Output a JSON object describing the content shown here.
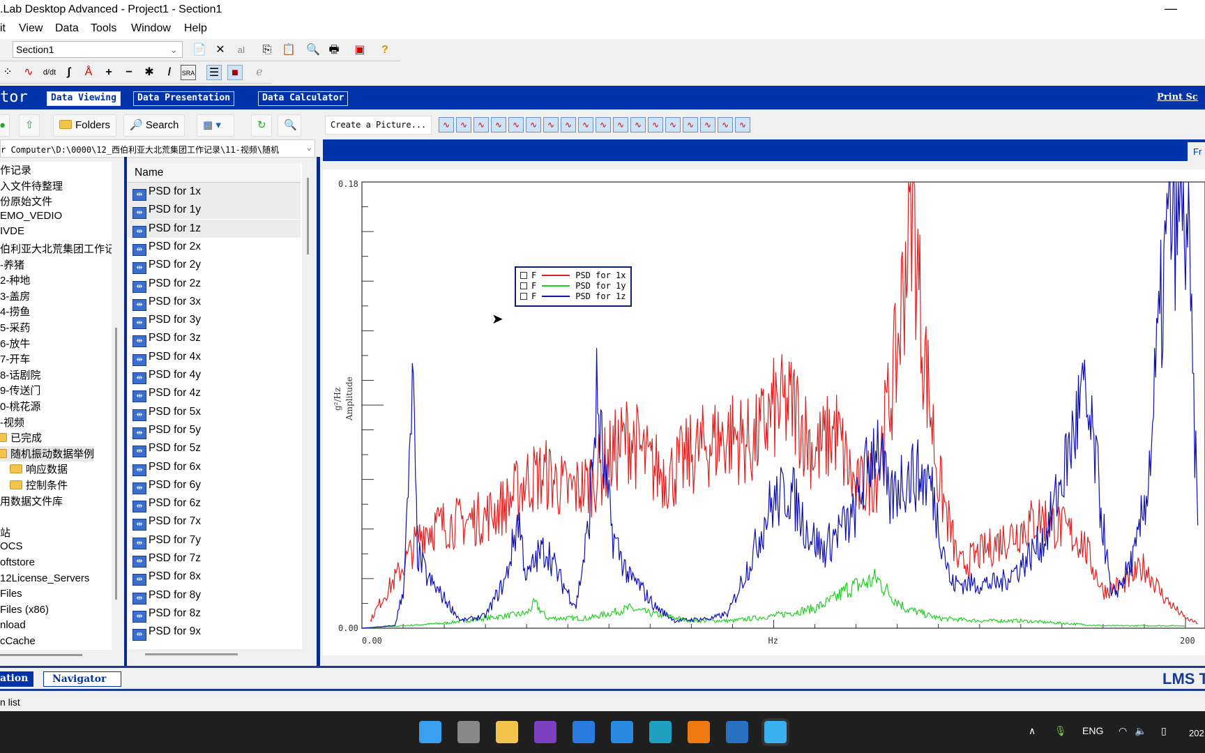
{
  "window": {
    "title": ".Lab Desktop Advanced - Project1 - Section1",
    "minimize": "—"
  },
  "menu": [
    "it",
    "View",
    "Data",
    "Tools",
    "Window",
    "Help"
  ],
  "toolbar": {
    "section_value": "Section1",
    "icons": [
      "new-document-icon",
      "delete-icon",
      "rename-icon",
      "copy-icon",
      "paste-icon",
      "print-preview-icon",
      "print-icon",
      "layout-icon",
      "help-icon"
    ]
  },
  "toolbar2": {
    "icons": [
      "scatter-icon",
      "curve-icon",
      "derivative-icon",
      "integral-icon",
      "annotate-icon",
      "plus-icon",
      "minus-icon",
      "multiply-icon",
      "divide-icon",
      "sra-icon",
      "list-view-icon",
      "save-icon",
      "web-icon"
    ]
  },
  "banner": {
    "app_fragment": "tor",
    "tabs": [
      "Data Viewing",
      "Data Presentation",
      "Data Calculator"
    ],
    "active_tab": "Data Viewing",
    "print_link": "Print Sc"
  },
  "nav": {
    "folders": "Folders",
    "search": "Search"
  },
  "path": "r Computer\\D:\\0000\\12_西伯利亚大北荒集团工作记录\\11-视频\\随机",
  "tree": [
    {
      "label": "作记录"
    },
    {
      "label": "入文件待整理"
    },
    {
      "label": "份原始文件"
    },
    {
      "label": "EMO_VEDIO"
    },
    {
      "label": "IVDE"
    },
    {
      "label": "伯利亚大北荒集团工作记"
    },
    {
      "label": "-养猪"
    },
    {
      "label": "2-种地"
    },
    {
      "label": "3-盖房"
    },
    {
      "label": "4-捞鱼"
    },
    {
      "label": "5-采药"
    },
    {
      "label": "6-放牛"
    },
    {
      "label": "7-开车"
    },
    {
      "label": "8-话剧院"
    },
    {
      "label": "9-传送门"
    },
    {
      "label": "0-桃花源"
    },
    {
      "label": "-视频"
    },
    {
      "label": "已完成",
      "folder": true
    },
    {
      "label": "随机振动数据举例",
      "folder": true,
      "selected": true
    },
    {
      "label": "响应数据",
      "folder": true,
      "indent": true
    },
    {
      "label": "控制条件",
      "folder": true,
      "indent": true
    },
    {
      "label": "用数据文件库"
    },
    {
      "label": ""
    },
    {
      "label": "站"
    },
    {
      "label": "OCS"
    },
    {
      "label": "oftstore"
    },
    {
      "label": "12License_Servers"
    },
    {
      "label": "Files"
    },
    {
      "label": "Files (x86)"
    },
    {
      "label": "nload"
    },
    {
      "label": "cCache"
    }
  ],
  "list": {
    "header": "Name",
    "items": [
      "PSD for 1x",
      "PSD for 1y",
      "PSD for 1z",
      "PSD for 2x",
      "PSD for 2y",
      "PSD for 2z",
      "PSD for 3x",
      "PSD for 3y",
      "PSD for 3z",
      "PSD for 4x",
      "PSD for 4y",
      "PSD for 4z",
      "PSD for 5x",
      "PSD for 5y",
      "PSD for 5z",
      "PSD for 6x",
      "PSD for 6y",
      "PSD for 6z",
      "PSD for 7x",
      "PSD for 7y",
      "PSD for 7z",
      "PSD for 8x",
      "PSD for 8y",
      "PSD for 8z",
      "PSD for 9x"
    ],
    "selected": [
      "PSD for 1x",
      "PSD for 1y",
      "PSD for 1z"
    ]
  },
  "chart_toolbar": {
    "create_picture": "Create a Picture...",
    "tab_fragment": "Fr"
  },
  "chart_data": {
    "type": "line",
    "xlabel": "Hz",
    "ylabel": "Amplitude",
    "yunit": "g²/Hz",
    "xlim": [
      0,
      200
    ],
    "ylim": [
      0,
      0.18
    ],
    "xtick_labels": [
      "0.00",
      "200"
    ],
    "ytick_labels": [
      "0.18",
      "0.00"
    ],
    "grid": false,
    "legend_placement": "top-left",
    "series": [
      {
        "name": "PSD for 1x",
        "flag": "F",
        "color": "#e02020",
        "x": [
          2,
          5,
          10,
          15,
          20,
          25,
          30,
          35,
          40,
          45,
          50,
          55,
          60,
          65,
          70,
          75,
          80,
          85,
          90,
          95,
          100,
          105,
          110,
          115,
          120,
          125,
          130,
          133.5,
          136,
          140,
          145,
          150,
          155,
          160,
          165,
          170,
          175,
          180,
          185,
          190,
          195,
          200,
          203
        ],
        "y": [
          0.003,
          0.012,
          0.025,
          0.04,
          0.042,
          0.043,
          0.045,
          0.05,
          0.06,
          0.062,
          0.055,
          0.058,
          0.068,
          0.078,
          0.065,
          0.062,
          0.07,
          0.075,
          0.078,
          0.074,
          0.088,
          0.09,
          0.07,
          0.08,
          0.055,
          0.062,
          0.11,
          0.178,
          0.12,
          0.06,
          0.025,
          0.03,
          0.035,
          0.04,
          0.045,
          0.04,
          0.035,
          0.015,
          0.018,
          0.025,
          0.012,
          0.004,
          0.002
        ]
      },
      {
        "name": "PSD for 1y",
        "flag": "F",
        "color": "#20d020",
        "x": [
          0,
          10,
          20,
          30,
          40,
          42,
          45,
          55,
          65,
          70,
          80,
          90,
          100,
          110,
          115,
          118,
          122,
          125,
          128,
          132,
          140,
          150,
          160,
          170,
          180,
          190,
          200
        ],
        "y": [
          0,
          0.001,
          0.002,
          0.004,
          0.006,
          0.01,
          0.004,
          0.004,
          0.008,
          0.006,
          0.003,
          0.003,
          0.005,
          0.008,
          0.012,
          0.016,
          0.018,
          0.02,
          0.014,
          0.008,
          0.004,
          0.003,
          0.003,
          0.002,
          0.001,
          0.001,
          0.001
        ]
      },
      {
        "name": "PSD for 1z",
        "flag": "F",
        "color": "#1010b0",
        "x": [
          0,
          8,
          10,
          11.5,
          12.3,
          13.5,
          16,
          20,
          24,
          30,
          35,
          38,
          40,
          43,
          45,
          48,
          52,
          55,
          57,
          59,
          61,
          65,
          67,
          71,
          76,
          85,
          89,
          95,
          99,
          104,
          108,
          112,
          116,
          119,
          122,
          125,
          128,
          131,
          134,
          138,
          141,
          143,
          150,
          155,
          160,
          166,
          170,
          175,
          178,
          182,
          185,
          188,
          191,
          193,
          196,
          199,
          200.5,
          203
        ],
        "y": [
          0,
          0.001,
          0.015,
          0.06,
          0.098,
          0.03,
          0.02,
          0.012,
          0.003,
          0.005,
          0.02,
          0.045,
          0.02,
          0.03,
          0.032,
          0.02,
          0.009,
          0.04,
          0.093,
          0.06,
          0.037,
          0.02,
          0.018,
          0.009,
          0.003,
          0.004,
          0.006,
          0.03,
          0.049,
          0.056,
          0.04,
          0.031,
          0.04,
          0.043,
          0.06,
          0.078,
          0.05,
          0.06,
          0.062,
          0.059,
          0.035,
          0.018,
          0.018,
          0.018,
          0.025,
          0.037,
          0.06,
          0.093,
          0.07,
          0.012,
          0.02,
          0.031,
          0.06,
          0.106,
          0.165,
          0.175,
          0.16,
          0.04
        ]
      }
    ]
  },
  "bottom": {
    "tab1": "ation",
    "tab2": "Navigator",
    "brand": "LMS T"
  },
  "status": "n list",
  "taskbar": {
    "apps": [
      "start-icon",
      "task-view-icon",
      "file-explorer-icon",
      "onenote-icon",
      "todo-icon",
      "mail-icon",
      "edge-icon",
      "search-app-icon",
      "notepad-icon",
      "lms-app-icon"
    ],
    "lang": "ENG",
    "clock": "202"
  }
}
